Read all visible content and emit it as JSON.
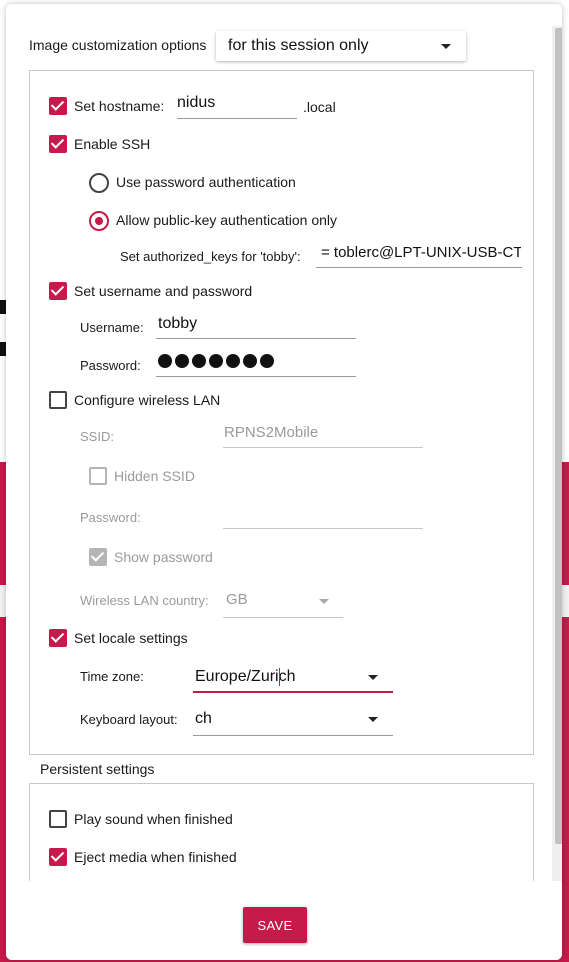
{
  "header": {
    "label": "Image customization options",
    "scope_value": "for this session only"
  },
  "hostname": {
    "label": "Set hostname:",
    "value": "nidus",
    "suffix": ".local",
    "checked": true
  },
  "ssh": {
    "label": "Enable SSH",
    "checked": true,
    "password_auth_label": "Use password authentication",
    "pubkey_auth_label": "Allow public-key authentication only",
    "selected": "pubkey",
    "authorized_keys_label": "Set authorized_keys for 'tobby':",
    "authorized_keys_value": "= toblerc@LPT-UNIX-USB-CT"
  },
  "user": {
    "label": "Set username and password",
    "checked": true,
    "username_label": "Username:",
    "username_value": "tobby",
    "password_label": "Password:",
    "password_dot_count": 7
  },
  "wifi": {
    "label": "Configure wireless LAN",
    "checked": false,
    "ssid_label": "SSID:",
    "ssid_value": "RPNS2Mobile",
    "hidden_label": "Hidden SSID",
    "hidden_checked": false,
    "password_label": "Password:",
    "password_value": "",
    "show_password_label": "Show password",
    "show_password_checked": true,
    "country_label": "Wireless LAN country:",
    "country_value": "GB"
  },
  "locale": {
    "label": "Set locale settings",
    "checked": true,
    "timezone_label": "Time zone:",
    "timezone_value": "Europe/Zurich",
    "keyboard_label": "Keyboard layout:",
    "keyboard_value": "ch"
  },
  "persistent": {
    "title": "Persistent settings",
    "play_sound_label": "Play sound when finished",
    "play_sound_checked": false,
    "eject_label": "Eject media when finished",
    "eject_checked": true
  },
  "footer": {
    "save_label": "SAVE"
  },
  "colors": {
    "accent": "#c51a4a",
    "disabled": "#9a9a9a"
  }
}
